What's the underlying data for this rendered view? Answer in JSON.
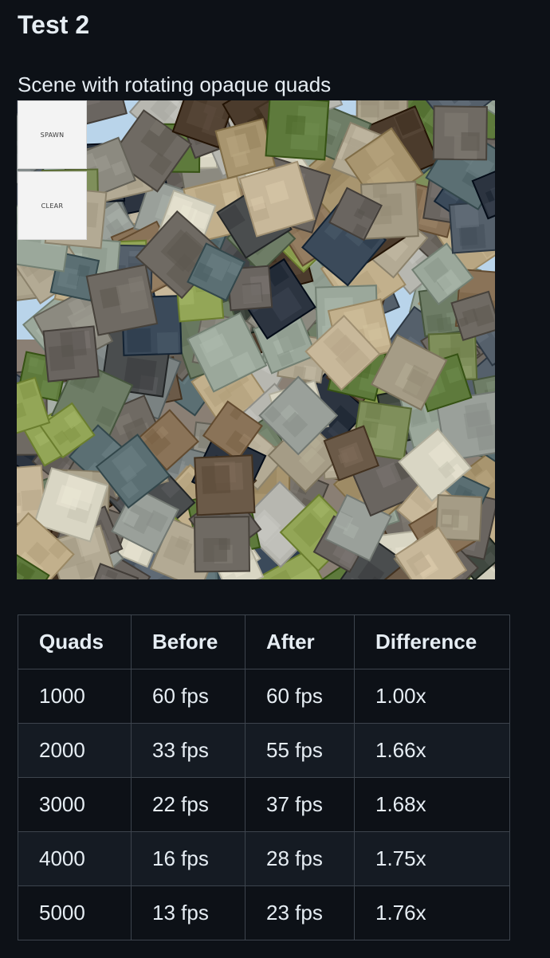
{
  "heading": "Test 2",
  "caption": "Scene with rotating opaque quads",
  "scene": {
    "buttons": {
      "spawn": "SPAWN",
      "clear": "CLEAR"
    },
    "sky_color": "#b9d4ea",
    "ground_color": "#8a7f74",
    "quad_palette": [
      "#6f6a63",
      "#8c8a80",
      "#a59c86",
      "#c8b89a",
      "#7f8f5b",
      "#5e7a3c",
      "#93a657",
      "#4a4d4e",
      "#6a6560",
      "#b3aa94",
      "#2c3440",
      "#3b4a5a",
      "#8a7358",
      "#6b5a48",
      "#d9d6c4",
      "#9aa09a",
      "#5b6f73",
      "#404840",
      "#a8956f",
      "#55606b",
      "#7a8282",
      "#c2b08c",
      "#4b3b2c",
      "#9ba89b",
      "#b7b7b0",
      "#6e7d66"
    ]
  },
  "table": {
    "headers": [
      "Quads",
      "Before",
      "After",
      "Difference"
    ],
    "rows": [
      [
        "1000",
        "60 fps",
        "60 fps",
        "1.00x"
      ],
      [
        "2000",
        "33 fps",
        "55 fps",
        "1.66x"
      ],
      [
        "3000",
        "22 fps",
        "37 fps",
        "1.68x"
      ],
      [
        "4000",
        "16 fps",
        "28 fps",
        "1.75x"
      ],
      [
        "5000",
        "13 fps",
        "23 fps",
        "1.76x"
      ]
    ]
  }
}
